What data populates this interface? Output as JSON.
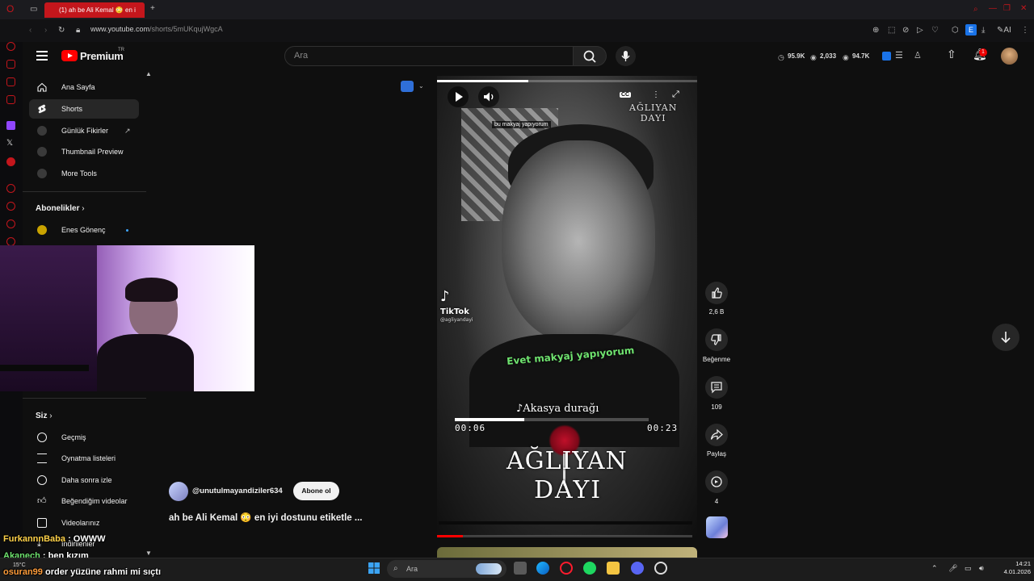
{
  "browser": {
    "tab_title": "(1) ah be Ali Kemal 😳 en i",
    "url_host": "www.youtube.com",
    "url_path": "/shorts/5mUKqujWgcA",
    "ai_label": "AI",
    "ext_badge": "E"
  },
  "header": {
    "brand": "Premium",
    "region": "TR",
    "search_placeholder": "Ara",
    "stats": [
      {
        "value": "95.9K"
      },
      {
        "value": "2,033"
      },
      {
        "value": "94.7K"
      }
    ],
    "notif_count": "1"
  },
  "nav": {
    "items": [
      {
        "label": "Ana Sayfa"
      },
      {
        "label": "Shorts"
      },
      {
        "label": "Günlük Fikirler"
      },
      {
        "label": "Thumbnail Preview"
      },
      {
        "label": "More Tools"
      }
    ],
    "subs_header": "Abonelikler",
    "subs": [
      {
        "label": "Enes Gönenç"
      }
    ],
    "you_header": "Siz",
    "you_items": [
      {
        "label": "Geçmiş"
      },
      {
        "label": "Oynatma listeleri"
      },
      {
        "label": "Daha sonra izle"
      },
      {
        "label": "Beğendiğim videolar"
      },
      {
        "label": "Videolarınız"
      },
      {
        "label": "İndirilenler"
      }
    ]
  },
  "video": {
    "small_caption": "bu makyaj yapıyorum",
    "watermark": "AĞLIYAN\nDAYI",
    "tiktok": "TikTok",
    "tiktok_handle": "@agliyandayi",
    "subtitle": "Evet makyaj yapıyorum",
    "song": "Akasya durağı",
    "time_start": "00:06",
    "time_end": "00:23",
    "big_title_1": "AĞLIYAN",
    "big_title_2": "DAYI",
    "cc_label": "CC",
    "inner_progress": 0.36,
    "top_progress": 0.35,
    "bottom_progress": 0.1
  },
  "actions": {
    "likes": "2,6 B",
    "dislike_label": "Beğenme",
    "comments": "109",
    "share_label": "Paylaş",
    "remix": "4"
  },
  "channel": {
    "name": "@unutulmayandiziler634",
    "subscribe": "Abone ol",
    "title": "ah be Ali Kemal 😳 en iyi dostunu etiketle ..."
  },
  "chat": [
    {
      "user": "FurkannnBaba",
      "text": " : OWWW"
    },
    {
      "user": "Akanech",
      "text": " : ben kızım"
    },
    {
      "user": "osuran99",
      "text": " order yüzüne rahmi mi sıçtı"
    }
  ],
  "taskbar": {
    "search": "Ara",
    "weather": "15°C",
    "time": "14:21",
    "date": "4.01.2026"
  }
}
